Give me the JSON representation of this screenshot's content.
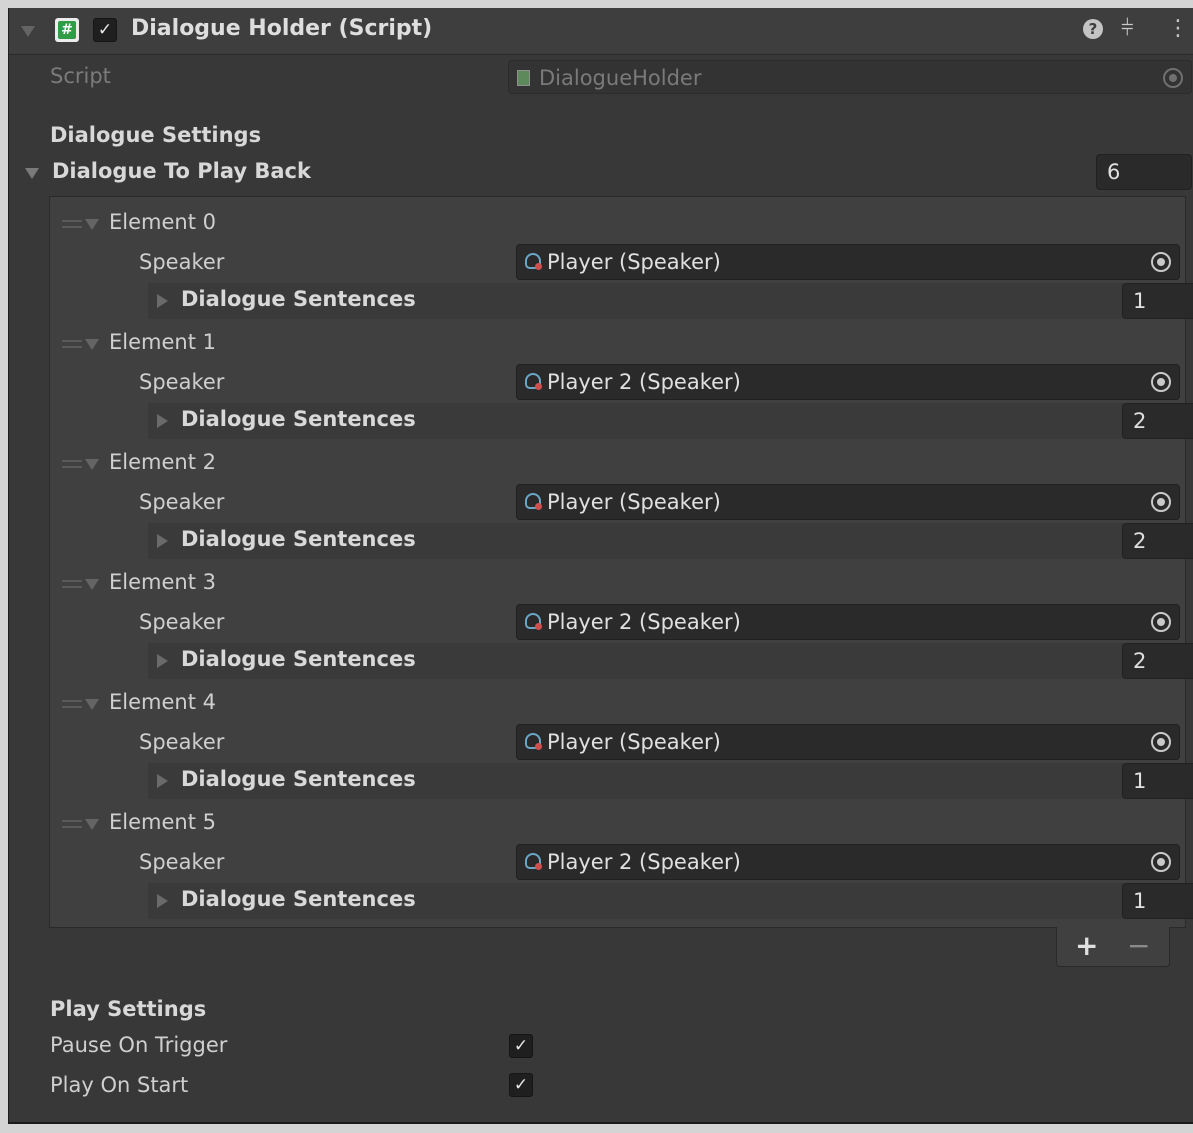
{
  "header": {
    "title": "Dialogue Holder (Script)",
    "script_icon": "#",
    "enabled_check": "✓",
    "icons": [
      "help-icon",
      "presets-icon",
      "context-menu-icon"
    ]
  },
  "script_field": {
    "label": "Script",
    "value": "DialogueHolder"
  },
  "dialogue_settings": {
    "heading": "Dialogue Settings",
    "list_label": "Dialogue To Play Back",
    "list_size": "6",
    "speaker_label": "Speaker",
    "sentences_label": "Dialogue Sentences",
    "elements": [
      {
        "label": "Element 0",
        "speaker": "Player (Speaker)",
        "sentences": "1"
      },
      {
        "label": "Element 1",
        "speaker": "Player 2 (Speaker)",
        "sentences": "2"
      },
      {
        "label": "Element 2",
        "speaker": "Player (Speaker)",
        "sentences": "2"
      },
      {
        "label": "Element 3",
        "speaker": "Player 2 (Speaker)",
        "sentences": "2"
      },
      {
        "label": "Element 4",
        "speaker": "Player (Speaker)",
        "sentences": "1"
      },
      {
        "label": "Element 5",
        "speaker": "Player 2 (Speaker)",
        "sentences": "1"
      }
    ],
    "add_label": "+",
    "remove_label": "−"
  },
  "play_settings": {
    "heading": "Play Settings",
    "pause_on_trigger": {
      "label": "Pause On Trigger",
      "checked": true
    },
    "play_on_start": {
      "label": "Play On Start",
      "checked": true
    },
    "check_glyph": "✓"
  },
  "colors": {
    "background": "#383838",
    "field": "#2a2a2a",
    "text": "#d2d2d2",
    "script_badge": "#2f9d46"
  }
}
